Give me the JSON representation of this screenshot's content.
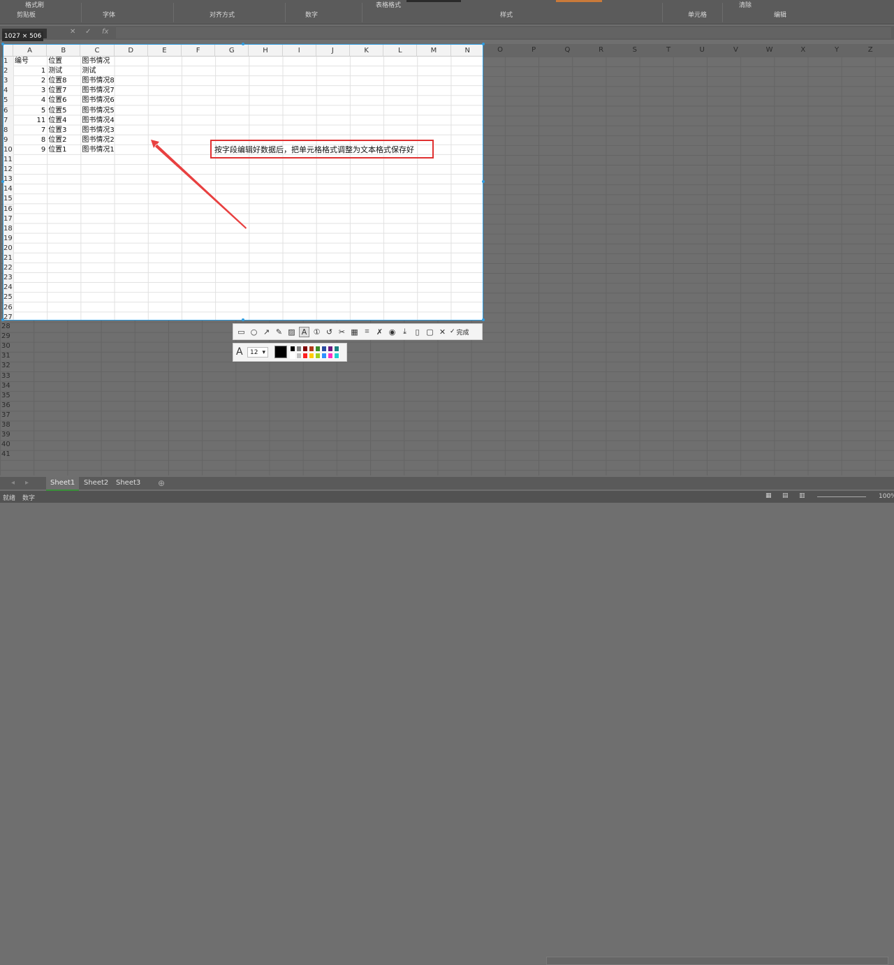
{
  "ribbon": {
    "groups": [
      "剪贴板",
      "字体",
      "对齐方式",
      "数字",
      "样式",
      "单元格",
      "编辑"
    ],
    "top_items": [
      "格式刷",
      "表格格式",
      "清除"
    ]
  },
  "formula_bar": {
    "name_box": "",
    "fx_label": "fx"
  },
  "capture": {
    "dimensions_label": "1027 × 506"
  },
  "sheet": {
    "columns": [
      "A",
      "B",
      "C",
      "D",
      "E",
      "F",
      "G",
      "H",
      "I",
      "J",
      "K",
      "L",
      "M",
      "N"
    ],
    "dim_columns": [
      "O",
      "P",
      "Q",
      "R",
      "S",
      "T",
      "U",
      "V",
      "W",
      "X",
      "Y",
      "Z"
    ],
    "rows": [
      "1",
      "2",
      "3",
      "4",
      "5",
      "6",
      "7",
      "8",
      "9",
      "10",
      "11",
      "12",
      "13",
      "14",
      "15",
      "16",
      "17",
      "18",
      "19",
      "20",
      "21",
      "22",
      "23",
      "24",
      "25",
      "26",
      "27"
    ],
    "dim_rows": [
      "28",
      "29",
      "30",
      "31",
      "32",
      "33",
      "34",
      "35",
      "36",
      "37",
      "38",
      "39",
      "40",
      "41"
    ],
    "table": {
      "headers": [
        "编号",
        "位置",
        "图书情况"
      ],
      "rows": [
        [
          "1",
          "测试",
          "测试"
        ],
        [
          "2",
          "位置8",
          "图书情况8"
        ],
        [
          "3",
          "位置7",
          "图书情况7"
        ],
        [
          "4",
          "位置6",
          "图书情况6"
        ],
        [
          "5",
          "位置5",
          "图书情况5"
        ],
        [
          "11",
          "位置4",
          "图书情况4"
        ],
        [
          "7",
          "位置3",
          "图书情况3"
        ],
        [
          "8",
          "位置2",
          "图书情况2"
        ],
        [
          "9",
          "位置1",
          "图书情况1"
        ]
      ]
    }
  },
  "annotation": {
    "text": "按字段编辑好数据后，把单元格格式调整为文本格式保存好",
    "border_color": "#e03030",
    "arrow_color": "#e84040"
  },
  "toolbar": {
    "tools": [
      "rectangle-icon",
      "ellipse-icon",
      "arrow-icon",
      "pen-icon",
      "marker-icon",
      "text-icon",
      "number-icon",
      "undo-icon",
      "mosaic-icon",
      "ocr-icon",
      "pin-icon",
      "translate-icon",
      "record-icon",
      "download-icon",
      "long-capture-icon",
      "save-icon"
    ],
    "cancel_glyph": "✕",
    "done_label": "完成",
    "font_glyph": "A",
    "font_size": "12",
    "current_color": "#000000",
    "palette_top": [
      "#000000",
      "#808080",
      "#800000",
      "#b03a1a",
      "#3a8a2a",
      "#2a4aa0",
      "#6a1a80",
      "#1a8080"
    ],
    "palette_bottom": [
      "#ffffff",
      "#c0c0c0",
      "#ff2020",
      "#ffcc00",
      "#a0d020",
      "#3090ff",
      "#ff30c0",
      "#20d0d0"
    ]
  },
  "sheet_tabs": [
    "Sheet1",
    "Sheet2",
    "Sheet3"
  ],
  "status": {
    "left": [
      "就绪",
      "数字"
    ],
    "zoom": "100%"
  }
}
